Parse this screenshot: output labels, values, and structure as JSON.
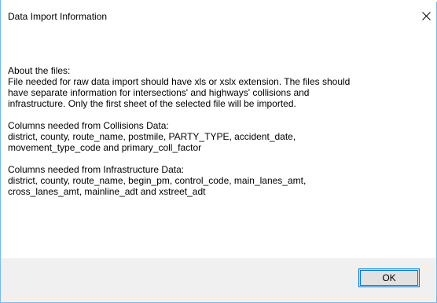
{
  "window": {
    "title": "Data Import Information",
    "close_icon": "close-icon"
  },
  "message": {
    "about_heading": "About the files:",
    "about_body": "File needed for raw data import should have xls or xslx extension. The files should\nhave separate information for intersections' and highways' collisions and\ninfrastructure. Only the first sheet of the selected file will be imported.",
    "collisions_heading": "Columns needed from Collisions Data:",
    "collisions_body": "   district, county, route_name, postmile, PARTY_TYPE, accident_date,\nmovement_type_code and primary_coll_factor",
    "infrastructure_heading": "Columns needed from Infrastructure Data:",
    "infrastructure_body": "   district, county, route_name, begin_pm, control_code, main_lanes_amt,\ncross_lanes_amt, mainline_adt and xstreet_adt"
  },
  "footer": {
    "ok_label": "OK"
  },
  "colors": {
    "accent": "#0078d7",
    "footer_bg": "#f0f0f0",
    "border": "#7fb8e6"
  }
}
